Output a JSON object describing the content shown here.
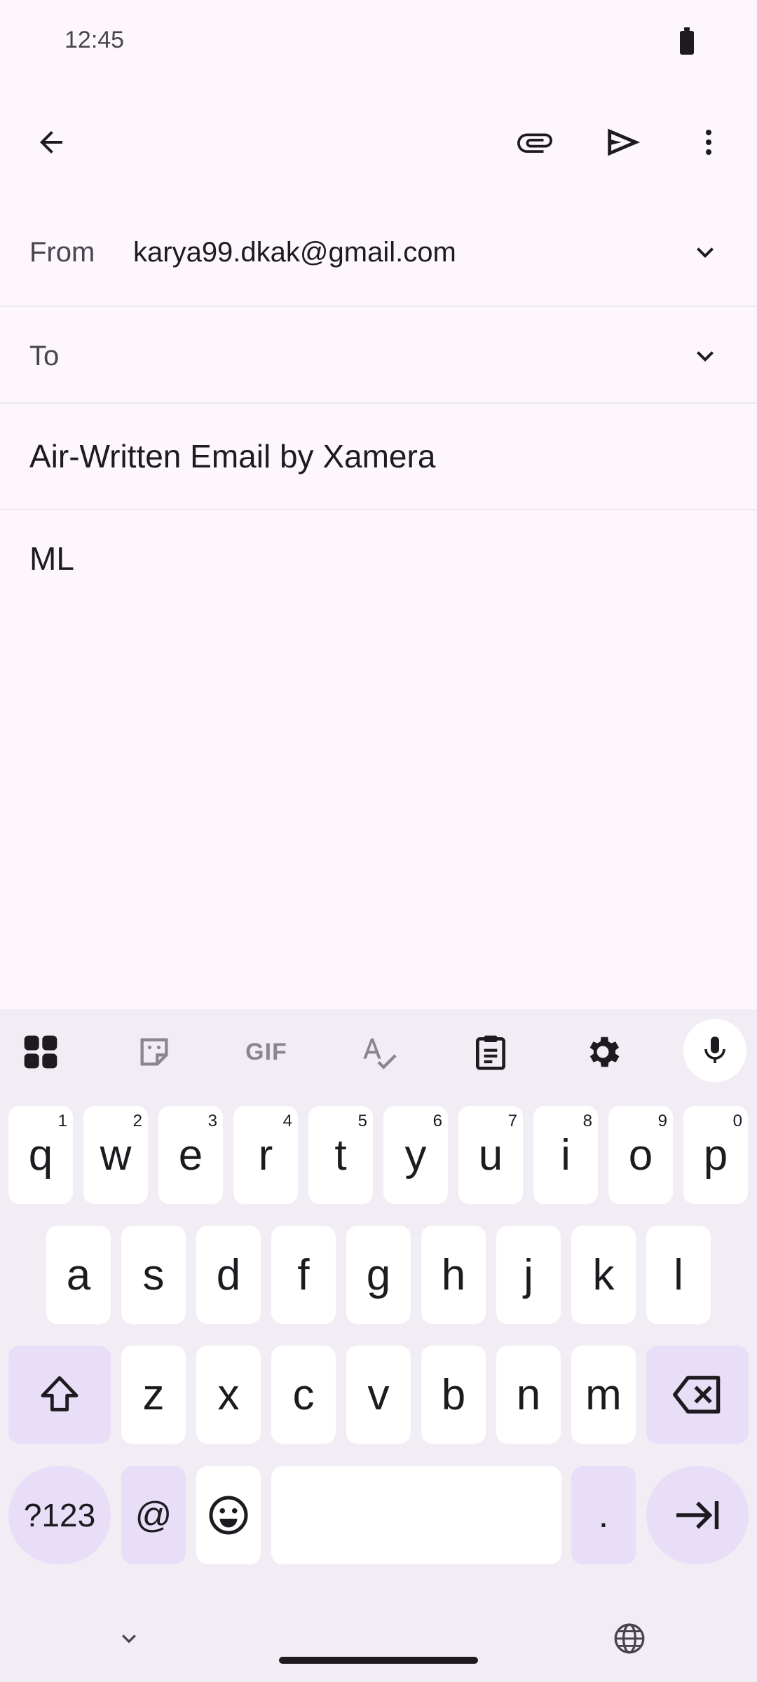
{
  "status_bar": {
    "time": "12:45"
  },
  "toolbar": {
    "back_icon": "arrow-back-icon",
    "attach_icon": "paperclip-icon",
    "send_icon": "send-icon",
    "more_icon": "more-vert-icon"
  },
  "compose": {
    "from_label": "From",
    "from_value": "karya99.dkak@gmail.com",
    "to_label": "To",
    "to_value": "",
    "subject": "Air-Written Email by Xamera",
    "body": "ML"
  },
  "keyboard": {
    "toolbar_icons": [
      "apps-grid-icon",
      "sticker-icon",
      "gif-icon",
      "spellcheck-icon",
      "clipboard-icon",
      "settings-gear-icon",
      "microphone-icon"
    ],
    "gif_label": "GIF",
    "row1": [
      {
        "letter": "q",
        "hint": "1"
      },
      {
        "letter": "w",
        "hint": "2"
      },
      {
        "letter": "e",
        "hint": "3"
      },
      {
        "letter": "r",
        "hint": "4"
      },
      {
        "letter": "t",
        "hint": "5"
      },
      {
        "letter": "y",
        "hint": "6"
      },
      {
        "letter": "u",
        "hint": "7"
      },
      {
        "letter": "i",
        "hint": "8"
      },
      {
        "letter": "o",
        "hint": "9"
      },
      {
        "letter": "p",
        "hint": "0"
      }
    ],
    "row2": [
      "a",
      "s",
      "d",
      "f",
      "g",
      "h",
      "j",
      "k",
      "l"
    ],
    "row3": [
      "z",
      "x",
      "c",
      "v",
      "b",
      "n",
      "m"
    ],
    "symbols_label": "?123",
    "at_label": "@",
    "period_label": ".",
    "space_label": ""
  },
  "colors": {
    "background": "#fdf7fd",
    "keyboard_bg": "#f2edf4",
    "function_key": "#e8def8",
    "key": "#ffffff"
  }
}
